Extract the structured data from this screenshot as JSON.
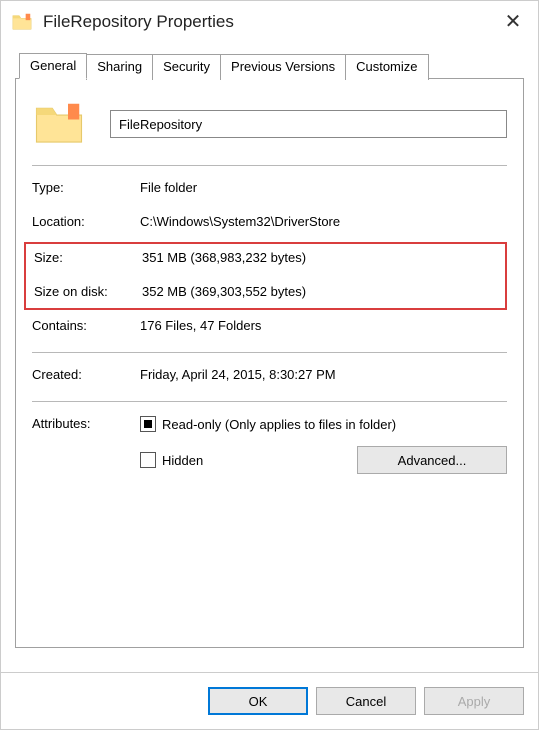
{
  "window": {
    "title": "FileRepository Properties"
  },
  "tabs": {
    "general": "General",
    "sharing": "Sharing",
    "security": "Security",
    "previous_versions": "Previous Versions",
    "customize": "Customize"
  },
  "folder": {
    "name": "FileRepository"
  },
  "labels": {
    "type": "Type:",
    "location": "Location:",
    "size": "Size:",
    "size_on_disk": "Size on disk:",
    "contains": "Contains:",
    "created": "Created:",
    "attributes": "Attributes:",
    "readonly": "Read-only (Only applies to files in folder)",
    "hidden": "Hidden",
    "advanced": "Advanced..."
  },
  "values": {
    "type": "File folder",
    "location": "C:\\Windows\\System32\\DriverStore",
    "size": "351 MB (368,983,232 bytes)",
    "size_on_disk": "352 MB (369,303,552 bytes)",
    "contains": "176 Files, 47 Folders",
    "created": "Friday, April 24, 2015, 8:30:27 PM"
  },
  "buttons": {
    "ok": "OK",
    "cancel": "Cancel",
    "apply": "Apply"
  }
}
